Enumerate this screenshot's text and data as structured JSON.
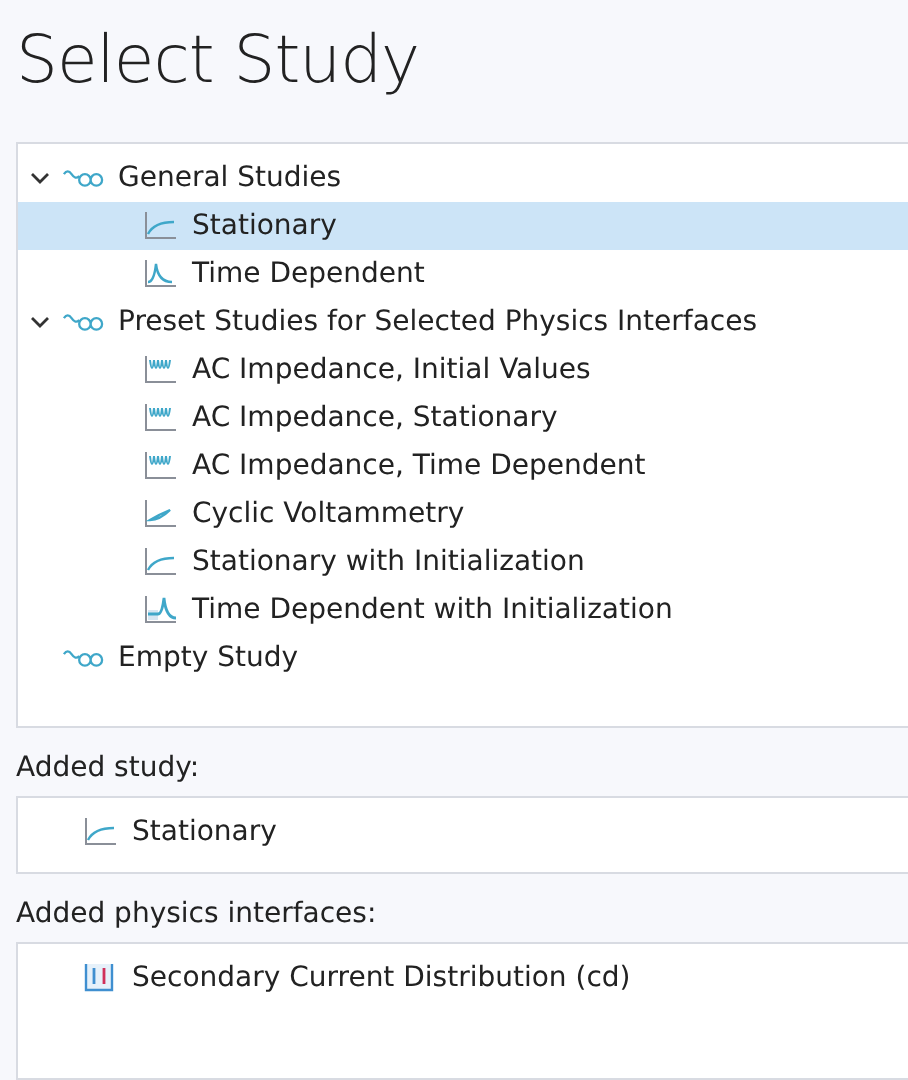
{
  "title": "Select Study",
  "tree": [
    {
      "label": "General Studies",
      "kind": "group",
      "expanded": true,
      "selected": false,
      "children": [
        {
          "label": "Stationary",
          "kind": "stationary",
          "selected": true
        },
        {
          "label": "Time Dependent",
          "kind": "transient",
          "selected": false
        }
      ]
    },
    {
      "label": "Preset Studies for Selected Physics Interfaces",
      "kind": "group",
      "expanded": true,
      "selected": false,
      "children": [
        {
          "label": "AC Impedance, Initial Values",
          "kind": "impedance",
          "selected": false
        },
        {
          "label": "AC Impedance, Stationary",
          "kind": "impedance",
          "selected": false
        },
        {
          "label": "AC Impedance, Time Dependent",
          "kind": "impedance",
          "selected": false
        },
        {
          "label": "Cyclic Voltammetry",
          "kind": "cyclic",
          "selected": false
        },
        {
          "label": "Stationary with Initialization",
          "kind": "stationary",
          "selected": false
        },
        {
          "label": "Time Dependent with Initialization",
          "kind": "initialized",
          "selected": false
        }
      ]
    },
    {
      "label": "Empty Study",
      "kind": "group",
      "selected": false
    }
  ],
  "added_study": {
    "label": "Added study:",
    "items": [
      {
        "label": "Stationary",
        "kind": "stationary"
      }
    ]
  },
  "added_physics": {
    "label": "Added physics interfaces:",
    "items": [
      {
        "label": "Secondary Current Distribution (cd)",
        "kind": "physics"
      }
    ]
  }
}
